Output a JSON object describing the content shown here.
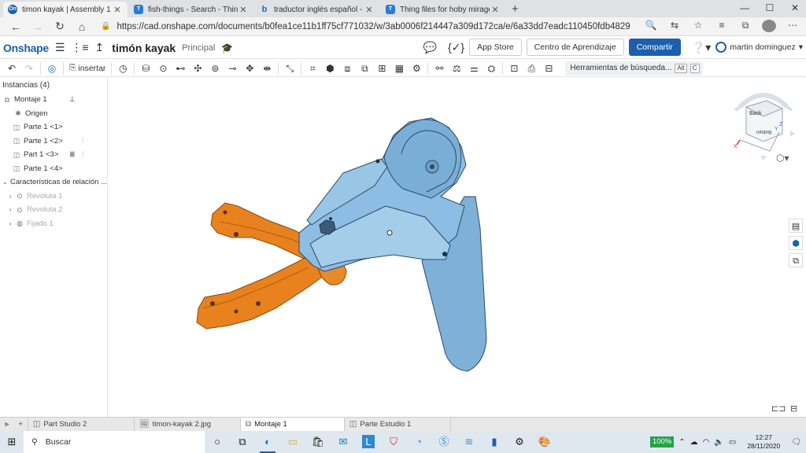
{
  "browser": {
    "tabs": [
      {
        "title": "timon kayak | Assembly 1",
        "favicon": "On",
        "active": true
      },
      {
        "title": "fish-things - Search - Thingiverse",
        "favicon": "T",
        "active": false
      },
      {
        "title": "traductor inglés español - Bing",
        "favicon": "b",
        "active": false
      },
      {
        "title": "Thing files for hoby mirage drive",
        "favicon": "T",
        "active": false
      }
    ],
    "new_tab": "+",
    "url": "https://cad.onshape.com/documents/b0fea1ce11b1ff75cf771032/w/3ab0006f214447a309d172ca/e/6a33dd7eadc110450fdb4829"
  },
  "app": {
    "logo": "Onshape",
    "doc_title": "timón kayak",
    "workspace": "Principal",
    "buttons": {
      "app_store": "App Store",
      "learning": "Centro de Aprendizaje",
      "share": "Compartir"
    },
    "user": "martin dominguez"
  },
  "toolbar": {
    "insert_label": "insertar",
    "search_tools": "Herramientas de búsqueda...",
    "shortcut_alt": "Alt",
    "shortcut_key": "C"
  },
  "instances": {
    "header": "Instancias (4)",
    "items": [
      {
        "label": "Montaje 1"
      },
      {
        "label": "Origen"
      },
      {
        "label": "Parte 1 <1>"
      },
      {
        "label": "Parte 1 <2>"
      },
      {
        "label": "Part 1 <3>"
      },
      {
        "label": "Parte 1 <4>"
      }
    ],
    "mates_header": "Características de relación ...",
    "mates": [
      {
        "label": "Revoluta 1"
      },
      {
        "label": "Revoluta 2"
      },
      {
        "label": "Fijado 1"
      }
    ]
  },
  "viewcube": {
    "face_label": "Back",
    "back_face_label": "Bottom",
    "axis_x": "X",
    "axis_y": "Y",
    "axis_z": "Z"
  },
  "bottom_tabs": [
    {
      "label": "Part Studio 2",
      "active": false
    },
    {
      "label": "timon-kayak 2.jpg",
      "active": false
    },
    {
      "label": "Montaje 1",
      "active": true
    },
    {
      "label": "Parte Estudio 1",
      "active": false
    }
  ],
  "taskbar": {
    "search_placeholder": "Buscar",
    "zoom": "100%",
    "time": "12:27",
    "date": "28/11/2020"
  },
  "colors": {
    "brand": "#1b5fae",
    "part_blue": "#7fb0d8",
    "part_orange": "#e8821e"
  }
}
